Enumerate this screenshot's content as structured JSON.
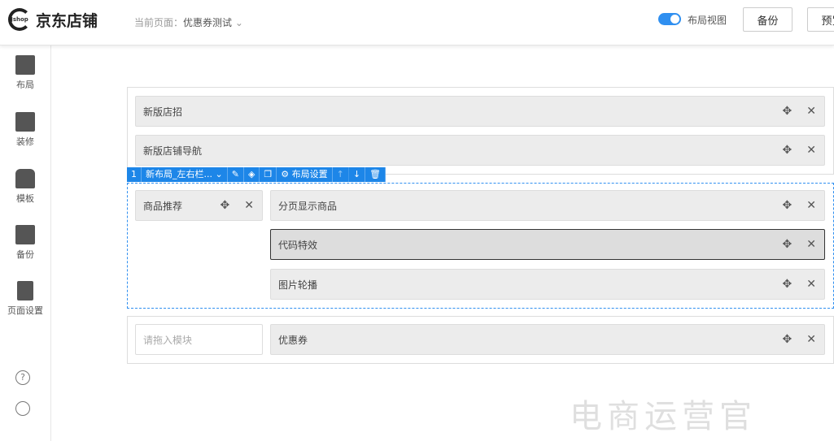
{
  "header": {
    "logo_mark": "Jshop",
    "logo_text": "京东店铺",
    "crumb_prefix": "当前页面：",
    "crumb_page": "优惠券测试",
    "toggle_label": "布局视图",
    "toggle_on": true,
    "backup": "备份",
    "preview": "预览"
  },
  "sidebar": {
    "items": [
      {
        "label": "布局",
        "icon": "layout-icon"
      },
      {
        "label": "装修",
        "icon": "paint-roller-icon"
      },
      {
        "label": "模板",
        "icon": "tshirt-icon"
      },
      {
        "label": "备份",
        "icon": "backup-icon"
      },
      {
        "label": "页面设置",
        "icon": "page-settings-icon"
      }
    ],
    "help": "?"
  },
  "sections": {
    "s1": [
      "新版店招",
      "新版店铺导航"
    ],
    "toolbar": {
      "index": "1",
      "name": "新布局_左右栏...",
      "settings": "布局设置"
    },
    "s2_left": [
      "商品推荐"
    ],
    "s2_right": [
      "分页显示商品",
      "代码特效",
      "图片轮播"
    ],
    "s3_placeholder": "请拖入模块",
    "s3_right": "优惠券"
  },
  "watermark": "电商运营官",
  "colors": {
    "accent": "#1d86e8"
  }
}
